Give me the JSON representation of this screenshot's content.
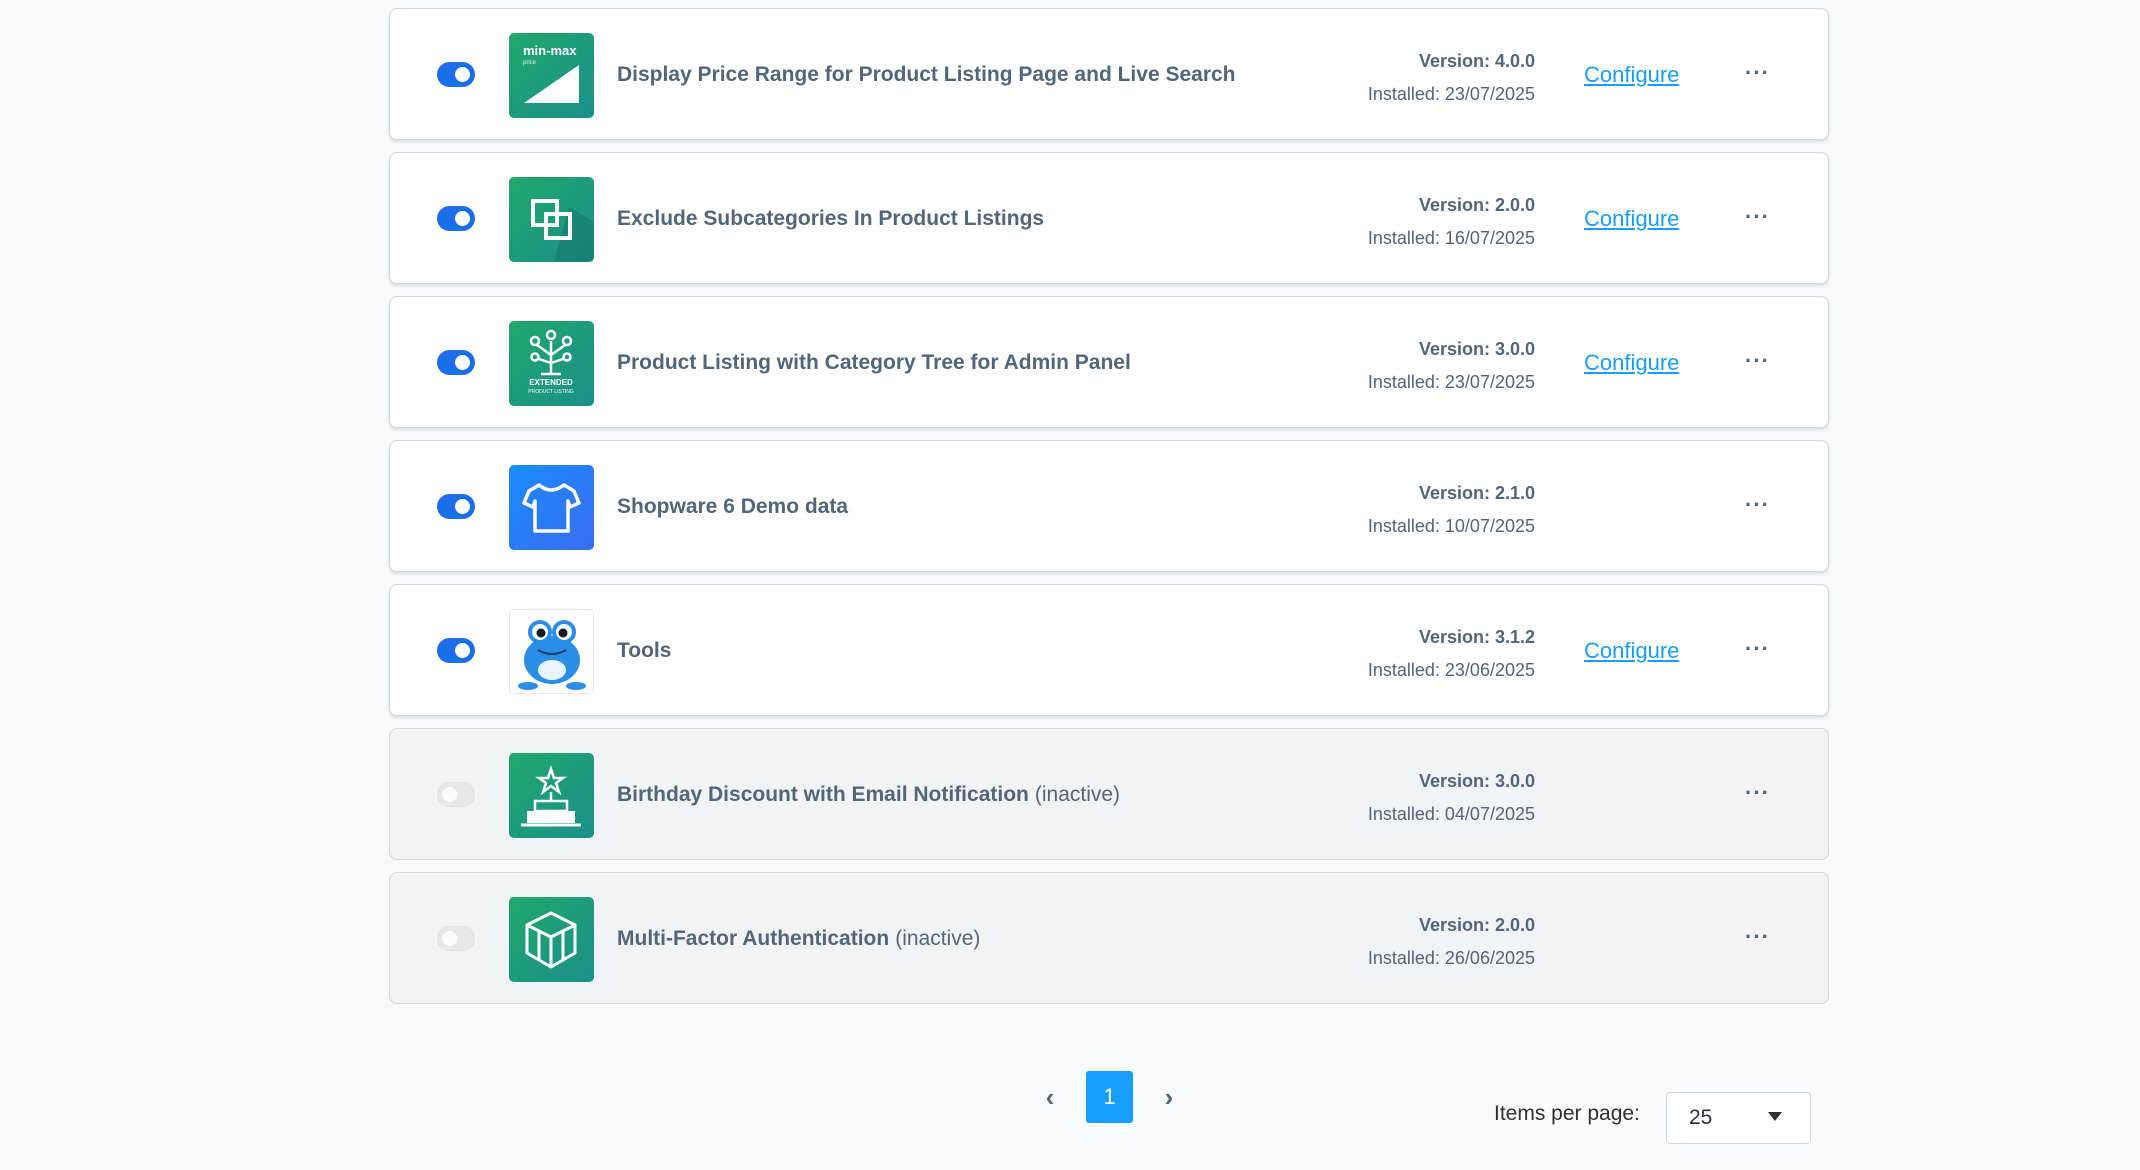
{
  "plugins": [
    {
      "name": "Display Price Range for Product Listing Page and Live Search",
      "suffix": "",
      "version": "Version: 4.0.0",
      "installed": "Installed: 23/07/2025",
      "configure": "Configure",
      "active": true,
      "icon": "min-max-price-icon",
      "icon_text": "min-max",
      "icon_sub": "price"
    },
    {
      "name": "Exclude Subcategories In Product Listings",
      "suffix": "",
      "version": "Version: 2.0.0",
      "installed": "Installed: 16/07/2025",
      "configure": "Configure",
      "active": true,
      "icon": "subcategories-icon"
    },
    {
      "name": "Product Listing with Category Tree for Admin Panel",
      "suffix": "",
      "version": "Version: 3.0.0",
      "installed": "Installed: 23/07/2025",
      "configure": "Configure",
      "active": true,
      "icon": "category-tree-icon",
      "icon_text": "EXTENDED",
      "icon_sub": "PRODUCT LISTING"
    },
    {
      "name": "Shopware 6 Demo data",
      "suffix": "",
      "version": "Version: 2.1.0",
      "installed": "Installed: 10/07/2025",
      "configure": "",
      "active": true,
      "icon": "t-shirt-icon"
    },
    {
      "name": "Tools",
      "suffix": "",
      "version": "Version: 3.1.2",
      "installed": "Installed: 23/06/2025",
      "configure": "Configure",
      "active": true,
      "icon": "frog-icon"
    },
    {
      "name": "Birthday Discount with Email Notification",
      "suffix": "(inactive)",
      "version": "Version: 3.0.0",
      "installed": "Installed: 04/07/2025",
      "configure": "",
      "active": false,
      "icon": "birthday-cake-icon"
    },
    {
      "name": "Multi-Factor Authentication",
      "suffix": "(inactive)",
      "version": "Version: 2.0.0",
      "installed": "Installed: 26/06/2025",
      "configure": "",
      "active": false,
      "icon": "cube-icon"
    }
  ],
  "more_glyph": "···",
  "pagination": {
    "prev": "‹",
    "current": "1",
    "next": "›"
  },
  "items_per_page": {
    "label": "Items per page:",
    "value": "25"
  },
  "colors": {
    "accent": "#189eff",
    "toggle_on": "#1a6fe8",
    "text": "#52667a"
  }
}
